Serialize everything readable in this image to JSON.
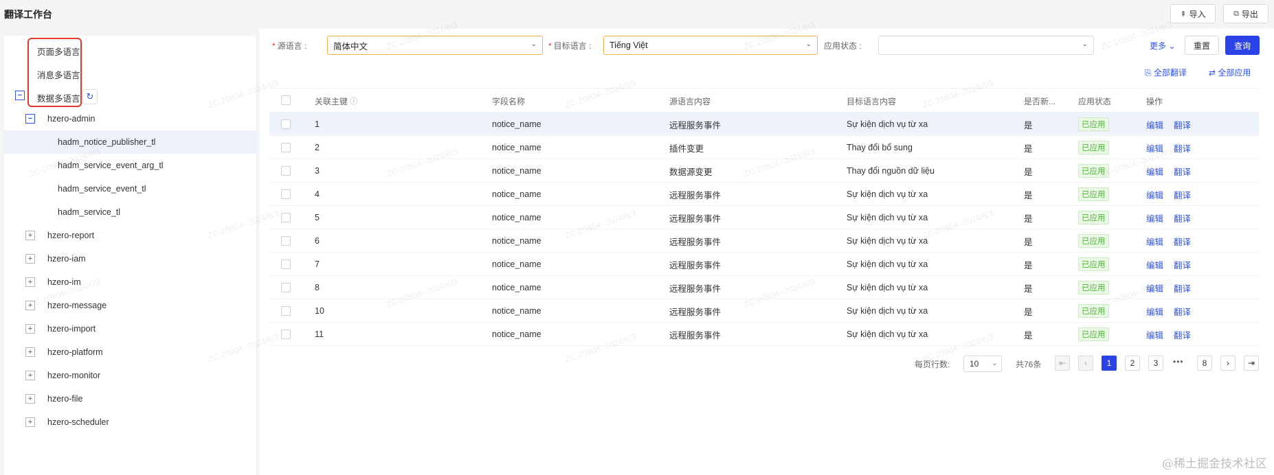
{
  "page_title": "翻译工作台",
  "top_actions": {
    "import": "导入",
    "export": "导出"
  },
  "lang_tabs": [
    "页面多语言",
    "消息多语言",
    "数据多语言"
  ],
  "tree": [
    {
      "label": "hzero-admin",
      "state": "minus"
    },
    {
      "label": "hadm_notice_publisher_tl",
      "state": "leaf"
    },
    {
      "label": "hadm_service_event_arg_tl",
      "state": "leaf"
    },
    {
      "label": "hadm_service_event_tl",
      "state": "leaf"
    },
    {
      "label": "hadm_service_tl",
      "state": "leaf"
    },
    {
      "label": "hzero-report",
      "state": "plus"
    },
    {
      "label": "hzero-iam",
      "state": "plus"
    },
    {
      "label": "hzero-im",
      "state": "plus"
    },
    {
      "label": "hzero-message",
      "state": "plus"
    },
    {
      "label": "hzero-import",
      "state": "plus"
    },
    {
      "label": "hzero-platform",
      "state": "plus"
    },
    {
      "label": "hzero-monitor",
      "state": "plus"
    },
    {
      "label": "hzero-file",
      "state": "plus"
    },
    {
      "label": "hzero-scheduler",
      "state": "plus"
    }
  ],
  "filters": {
    "source_lang_label": "源语言 :",
    "source_lang_value": "简体中文",
    "target_lang_label": "目标语言 :",
    "target_lang_value": "Tiếng Việt",
    "app_status_label": "应用状态 :",
    "app_status_value": "",
    "more": "更多",
    "reset": "重置",
    "query": "查询"
  },
  "batch_actions": {
    "translate_all": "全部翻译",
    "apply_all": "全部应用"
  },
  "table": {
    "headers": [
      "关联主键",
      "字段名称",
      "源语言内容",
      "目标语言内容",
      "是否新...",
      "应用状态",
      "操作"
    ],
    "rows": [
      {
        "key": "1",
        "field": "notice_name",
        "source": "远程服务事件",
        "target": "Sự kiện dịch vụ từ xa",
        "is_new": "是",
        "status": "已应用"
      },
      {
        "key": "2",
        "field": "notice_name",
        "source": "插件变更",
        "target": "Thay đổi bổ sung",
        "is_new": "是",
        "status": "已应用"
      },
      {
        "key": "3",
        "field": "notice_name",
        "source": "数据源变更",
        "target": "Thay đổi nguồn dữ liệu",
        "is_new": "是",
        "status": "已应用"
      },
      {
        "key": "4",
        "field": "notice_name",
        "source": "远程服务事件",
        "target": "Sự kiện dịch vụ từ xa",
        "is_new": "是",
        "status": "已应用"
      },
      {
        "key": "5",
        "field": "notice_name",
        "source": "远程服务事件",
        "target": "Sự kiện dịch vụ từ xa",
        "is_new": "是",
        "status": "已应用"
      },
      {
        "key": "6",
        "field": "notice_name",
        "source": "远程服务事件",
        "target": "Sự kiện dịch vụ từ xa",
        "is_new": "是",
        "status": "已应用"
      },
      {
        "key": "7",
        "field": "notice_name",
        "source": "远程服务事件",
        "target": "Sự kiện dịch vụ từ xa",
        "is_new": "是",
        "status": "已应用"
      },
      {
        "key": "8",
        "field": "notice_name",
        "source": "远程服务事件",
        "target": "Sự kiện dịch vụ từ xa",
        "is_new": "是",
        "status": "已应用"
      },
      {
        "key": "10",
        "field": "notice_name",
        "source": "远程服务事件",
        "target": "Sự kiện dịch vụ từ xa",
        "is_new": "是",
        "status": "已应用"
      },
      {
        "key": "11",
        "field": "notice_name",
        "source": "远程服务事件",
        "target": "Sự kiện dịch vụ từ xa",
        "is_new": "是",
        "status": "已应用"
      }
    ],
    "row_actions": {
      "edit": "编辑",
      "translate": "翻译"
    }
  },
  "pagination": {
    "page_size_label": "每页行数:",
    "page_size": "10",
    "total": "共76条",
    "pages": [
      "1",
      "2",
      "3"
    ],
    "ellipsis": "•••",
    "last_page": "8",
    "current": "1"
  },
  "watermark": "ZC-20804--2024/6/3",
  "credit": "@稀土掘金技术社区",
  "colors": {
    "primary": "#2a43e6",
    "danger_border": "#e0382d",
    "success": "#52b43a"
  }
}
